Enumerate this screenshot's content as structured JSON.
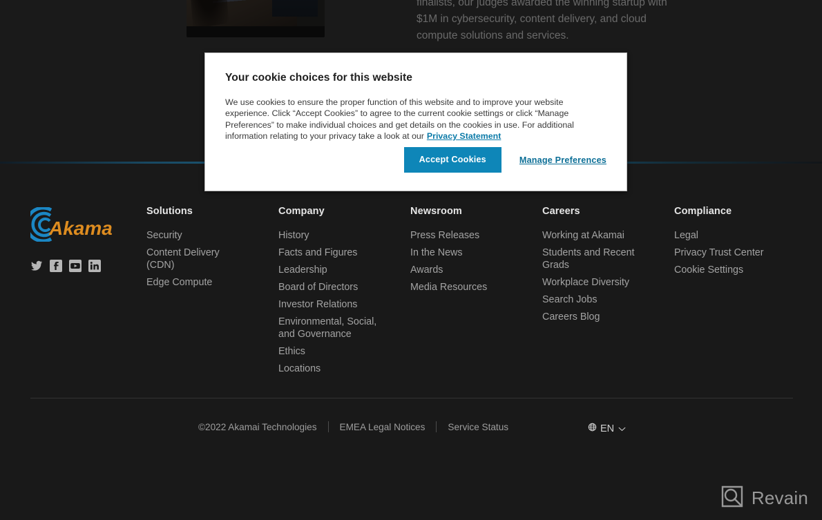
{
  "hero": {
    "paragraph": "finalists, our judges awarded the winning startup with $1M in cybersecurity, content delivery, and cloud compute solutions and services.",
    "image_alt": "presenter-on-stage-photo"
  },
  "cookie_modal": {
    "title": "Your cookie choices for this website",
    "body": "We use cookies to ensure the proper function of this website and to improve your website experience. Click “Accept Cookies” to agree to the current cookie settings or click “Manage Preferences” to make individual choices and get details on the cookies in use. For additional information relating to your privacy take a look at our",
    "privacy_link": "Privacy Statement",
    "accept_label": "Accept Cookies",
    "manage_label": "Manage Preferences",
    "accept_color": "#0e86b8",
    "link_color": "#0b7aa8"
  },
  "footer": {
    "logo_text": "Akamai",
    "logo_colors": {
      "arc": "#1b87c4",
      "wordmark": "#dd8c20"
    },
    "social": [
      {
        "name": "twitter-icon",
        "label": "Twitter"
      },
      {
        "name": "facebook-icon",
        "label": "Facebook"
      },
      {
        "name": "youtube-icon",
        "label": "YouTube"
      },
      {
        "name": "linkedin-icon",
        "label": "LinkedIn"
      }
    ],
    "columns": [
      {
        "heading": "Solutions",
        "links": [
          "Security",
          "Content Delivery (CDN)",
          "Edge Compute"
        ]
      },
      {
        "heading": "Company",
        "links": [
          "History",
          "Facts and Figures",
          "Leadership",
          "Board of Directors",
          "Investor Relations",
          "Environmental, Social, and Governance",
          "Ethics",
          "Locations"
        ]
      },
      {
        "heading": "Newsroom",
        "links": [
          "Press Releases",
          "In the News",
          "Awards",
          "Media Resources"
        ]
      },
      {
        "heading": "Careers",
        "links": [
          "Working at Akamai",
          "Students and Recent Grads",
          "Workplace Diversity",
          "Search Jobs",
          "Careers Blog"
        ]
      },
      {
        "heading": "Compliance",
        "links": [
          "Legal",
          "Privacy Trust Center",
          "Cookie Settings"
        ]
      }
    ],
    "bottom": {
      "copyright": "©2022 Akamai Technologies",
      "links": [
        "EMEA Legal Notices",
        "Service Status"
      ],
      "language": "EN"
    }
  },
  "watermark": {
    "text": "Revain"
  }
}
